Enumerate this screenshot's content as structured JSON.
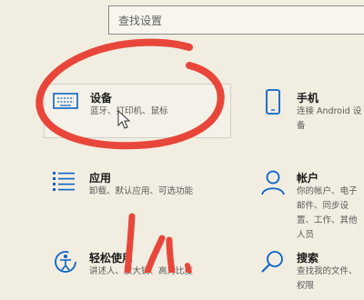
{
  "search": {
    "placeholder": "查找设置"
  },
  "tiles": [
    {
      "title": "设备",
      "desc": "蓝牙、打印机、鼠标",
      "icon": "keyboard-icon"
    },
    {
      "title": "手机",
      "desc": "连接 Android 设备",
      "icon": "phone-icon"
    },
    {
      "title": "应用",
      "desc": "卸载、默认应用、可选功能",
      "icon": "apps-list-icon"
    },
    {
      "title": "帐户",
      "desc": "你的帐户、电子邮件、同步设置、工作、其他人员",
      "icon": "person-icon"
    },
    {
      "title": "轻松使用",
      "desc": "讲述人、放大镜、高对比度",
      "icon": "ease-of-access-icon"
    },
    {
      "title": "搜索",
      "desc": "查找我的文件、权限",
      "icon": "search-icon"
    }
  ],
  "colors": {
    "accent": "#0a63c6",
    "annotation": "#e8463a",
    "background": "#f1ede1"
  }
}
